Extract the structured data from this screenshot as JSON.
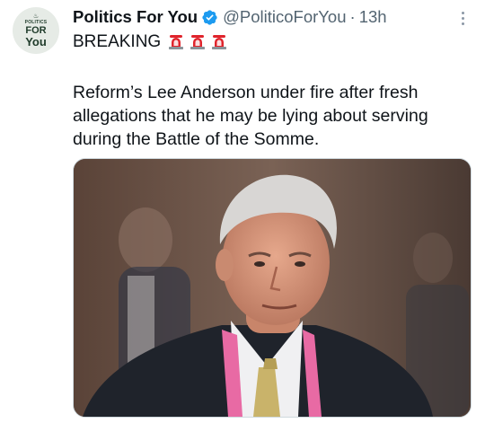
{
  "account": {
    "avatar_lines": [
      "POLITICS",
      "FOR",
      "You"
    ],
    "name": "Politics For You",
    "handle": "@PoliticoForYou",
    "separator": "·",
    "time": "13h",
    "verified": true
  },
  "tweet": {
    "headline": "BREAKING",
    "siren_icon": "police-car-light-emoji",
    "siren_count": 3,
    "body": "Reform’s Lee Anderson under fire after fresh allegations that he may be lying about serving during the Battle of the Somme."
  },
  "media": {
    "type": "photo"
  },
  "colors": {
    "text": "#0f1419",
    "secondary": "#536471",
    "verified_blue": "#1d9bf0",
    "siren_red": "#e0242c"
  }
}
